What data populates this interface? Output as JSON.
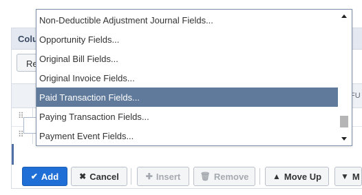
{
  "panel": {
    "title": "Colu",
    "reset_label": "Re",
    "column_header_label": "FU"
  },
  "rows": [
    {
      "handle": "⠿"
    },
    {
      "handle": "⠿"
    }
  ],
  "dropdown": {
    "items": [
      {
        "label": "Non-Deductible Adjustment Journal Fields...",
        "selected": false
      },
      {
        "label": "Opportunity Fields...",
        "selected": false
      },
      {
        "label": "Original Bill Fields...",
        "selected": false
      },
      {
        "label": "Original Invoice Fields...",
        "selected": false
      },
      {
        "label": "Paid Transaction Fields...",
        "selected": true
      },
      {
        "label": "Paying Transaction Fields...",
        "selected": false
      },
      {
        "label": "Payment Event Fields...",
        "selected": false
      }
    ],
    "selected_color": "#607a9c"
  },
  "toolbar": {
    "add_label": "Add",
    "cancel_label": "Cancel",
    "insert_label": "Insert",
    "remove_label": "Remove",
    "move_up_label": "Move Up",
    "move_down_label": "M"
  },
  "colors": {
    "primary": "#1f6fd6",
    "header_bg": "#e4e9f1"
  },
  "icons": {
    "add": "check-icon",
    "cancel": "x-icon",
    "insert": "plus-icon",
    "remove": "trash-icon",
    "move_up": "arrow-up-icon",
    "move_down": "arrow-down-icon"
  }
}
